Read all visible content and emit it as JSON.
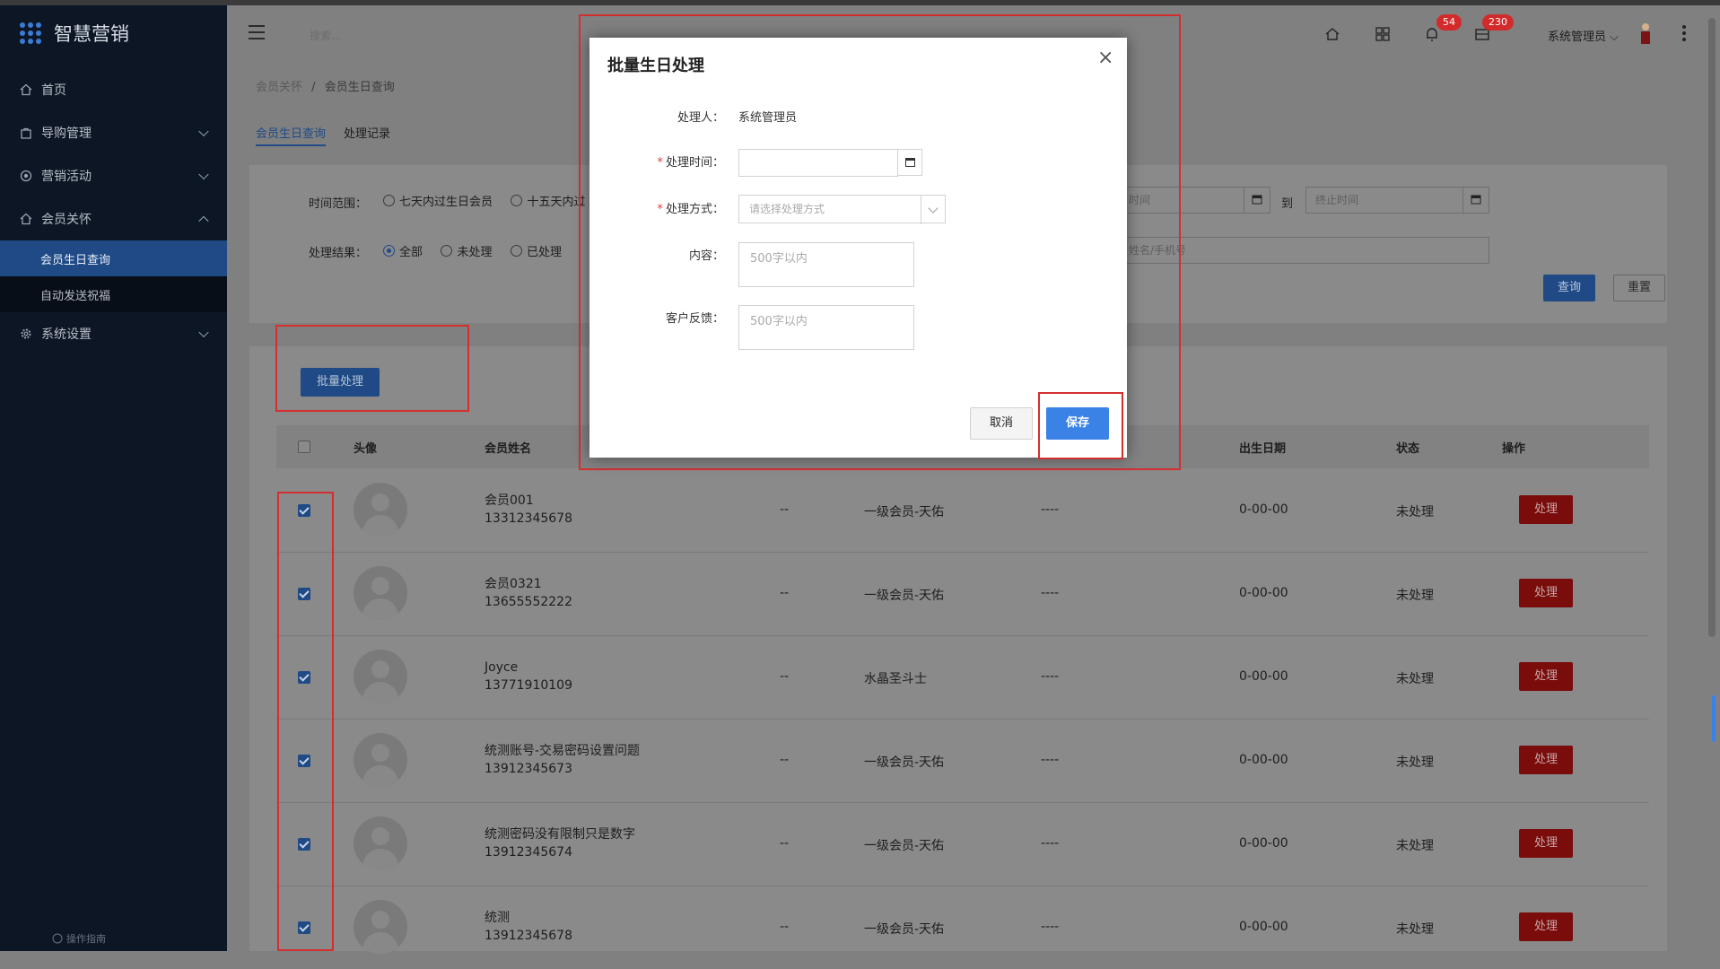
{
  "app": {
    "title": "智慧营销"
  },
  "sidebar": {
    "items": [
      {
        "label": "首页",
        "icon": "home-icon"
      },
      {
        "label": "导购管理",
        "icon": "bag-icon"
      },
      {
        "label": "营销活动",
        "icon": "target-icon"
      },
      {
        "label": "会员关怀",
        "icon": "home-care-icon"
      },
      {
        "label": "系统设置",
        "icon": "gear-icon"
      }
    ],
    "subitems": [
      {
        "label": "会员生日查询",
        "active": true
      },
      {
        "label": "自动发送祝福",
        "active": false
      }
    ],
    "guide": "操作指南"
  },
  "header": {
    "search_placeholder": "搜索...",
    "notif_badge": "54",
    "msg_badge": "230",
    "user": "系统管理员"
  },
  "breadcrumb": {
    "parent": "会员关怀",
    "separator": "/",
    "current": "会员生日查询"
  },
  "tabs": [
    {
      "label": "会员生日查询",
      "active": true
    },
    {
      "label": "处理记录",
      "active": false
    }
  ],
  "filters": {
    "range_label": "时间范围：",
    "range_options": [
      "七天内过生日会员",
      "十五天内过"
    ],
    "start_placeholder": "时间",
    "to_label": "到",
    "end_placeholder": "终止时间",
    "result_label": "处理结果：",
    "result_options": [
      "全部",
      "未处理",
      "已处理"
    ],
    "result_selected": "全部",
    "keyword_placeholder": "姓名/手机号",
    "query_button": "查询",
    "reset_button": "重置"
  },
  "batch_button": "批量处理",
  "table": {
    "headers": [
      "头像",
      "会员姓名",
      "出生日期",
      "状态",
      "操作"
    ],
    "rows": [
      {
        "name": "会员001",
        "phone": "13312345678",
        "c1": "--",
        "level": "一级会员-天佑",
        "c3": "----",
        "birth": "0-00-00",
        "status": "未处理",
        "action": "处理"
      },
      {
        "name": "会员0321",
        "phone": "13655552222",
        "c1": "--",
        "level": "一级会员-天佑",
        "c3": "----",
        "birth": "0-00-00",
        "status": "未处理",
        "action": "处理"
      },
      {
        "name": "Joyce",
        "phone": "13771910109",
        "c1": "--",
        "level": "水晶圣斗士",
        "c3": "----",
        "birth": "0-00-00",
        "status": "未处理",
        "action": "处理"
      },
      {
        "name": "统测账号-交易密码设置问题",
        "phone": "13912345673",
        "c1": "--",
        "level": "一级会员-天佑",
        "c3": "----",
        "birth": "0-00-00",
        "status": "未处理",
        "action": "处理"
      },
      {
        "name": "统测密码没有限制只是数字",
        "phone": "13912345674",
        "c1": "--",
        "level": "一级会员-天佑",
        "c3": "----",
        "birth": "0-00-00",
        "status": "未处理",
        "action": "处理"
      },
      {
        "name": "统测",
        "phone": "13912345678",
        "c1": "--",
        "level": "一级会员-天佑",
        "c3": "----",
        "birth": "0-00-00",
        "status": "未处理",
        "action": "处理"
      }
    ]
  },
  "modal": {
    "title": "批量生日处理",
    "handler_label": "处理人：",
    "handler_value": "系统管理员",
    "time_label": "处理时间：",
    "method_label": "处理方式：",
    "method_placeholder": "请选择处理方式",
    "content_label": "内容：",
    "content_placeholder": "500字以内",
    "feedback_label": "客户反馈：",
    "feedback_placeholder": "500字以内",
    "cancel": "取消",
    "save": "保存",
    "required_mark": "*",
    "close_glyph": "×"
  }
}
